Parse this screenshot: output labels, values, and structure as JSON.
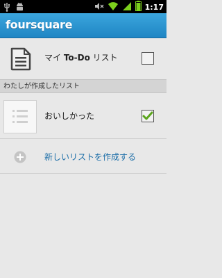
{
  "status_bar": {
    "time": "1:17",
    "icons": [
      "usb-icon",
      "android-icon",
      "mute-icon",
      "wifi-icon",
      "signal-icon",
      "battery-icon"
    ]
  },
  "app": {
    "logo_text": "foursquare",
    "brand_color": "#2a96d2"
  },
  "todo_row": {
    "label_prefix": "マイ ",
    "label_bold": "To-Do",
    "label_suffix": " リスト",
    "checked": false
  },
  "section": {
    "title": "わたしが作成したリスト"
  },
  "lists": [
    {
      "name": "おいしかった",
      "checked": true
    }
  ],
  "create_row": {
    "label": "新しいリストを作成する",
    "link_color": "#1c6ea8"
  }
}
